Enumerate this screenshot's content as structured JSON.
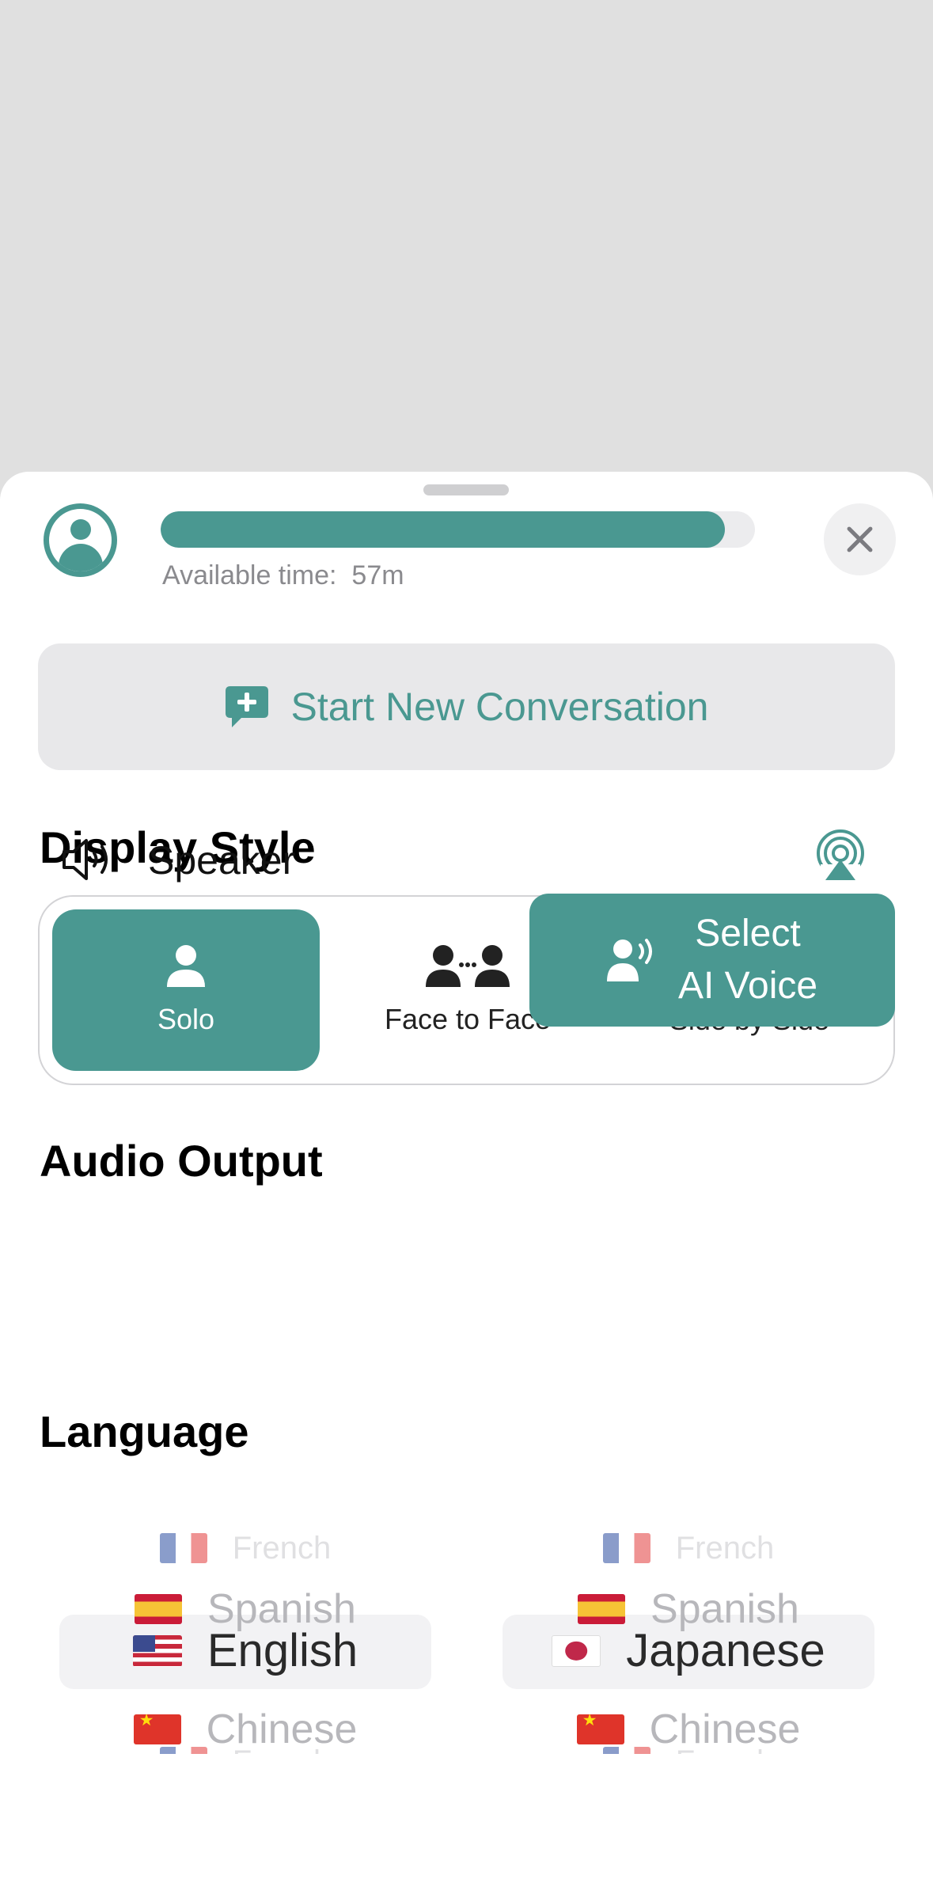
{
  "header": {
    "progress_fraction": 0.95,
    "available_time_label": "Available time:",
    "available_time_value": "57m",
    "close_icon": "xmark-icon"
  },
  "start_conversation": {
    "label": "Start New Conversation",
    "icon": "chat-plus-icon"
  },
  "display_style": {
    "title": "Display Style",
    "options": [
      {
        "label": "Solo",
        "icon": "person-icon",
        "selected": true
      },
      {
        "label": "Face to Face",
        "icon": "face-to-face-icon",
        "selected": false
      },
      {
        "label": "Side by Side",
        "icon": "two-people-icon",
        "selected": false
      }
    ]
  },
  "audio_output": {
    "title": "Audio Output",
    "device_label": "Speaker",
    "device_icon": "speaker-icon",
    "route_icon": "airplay-icon"
  },
  "language": {
    "title": "Language",
    "select_voice": {
      "line1": "Select",
      "line2": "AI Voice",
      "icon": "voice-person-icon"
    },
    "source_wheel": [
      {
        "name": "French",
        "flag": "fr"
      },
      {
        "name": "Spanish",
        "flag": "es"
      },
      {
        "name": "English",
        "flag": "us",
        "selected": true
      },
      {
        "name": "Chinese",
        "flag": "cn"
      },
      {
        "name": "French",
        "flag": "fr"
      }
    ],
    "target_wheel": [
      {
        "name": "French",
        "flag": "fr"
      },
      {
        "name": "Spanish",
        "flag": "es"
      },
      {
        "name": "Japanese",
        "flag": "jp",
        "selected": true
      },
      {
        "name": "Chinese",
        "flag": "cn"
      },
      {
        "name": "French",
        "flag": "fr"
      }
    ]
  },
  "colors": {
    "accent": "#4a9891",
    "backdrop": "#e0e0e0",
    "button_bg": "#e8e8ea"
  }
}
